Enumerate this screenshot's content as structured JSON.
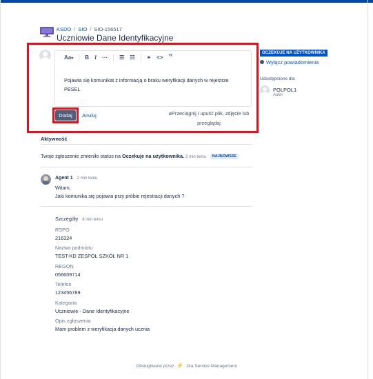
{
  "breadcrumb": {
    "project": "KSDO",
    "service": "SIO",
    "issue": "SIO-156517"
  },
  "request": {
    "title": "Uczniowie Dane Identyfikacyjne"
  },
  "editor": {
    "text_style_label": "Aa",
    "text": "Pojawia się komunikat z informacją o braku weryfikacji danych w rejestrze PESEL",
    "add_button": "Dodaj",
    "cancel_link": "Anuluj",
    "drop_hint": "Przeciągnij i upuść plik, zdjęcie lub",
    "browse_link": "przeglądaj"
  },
  "sidebar": {
    "status": "OCZEKUJE NA UŻYTKOWNIKA",
    "notifications": "Wyłącz powiadomienia",
    "shared_with_label": "Udostępnione dla",
    "user": {
      "name": "POLPOL1",
      "role": "Autor"
    }
  },
  "activity": {
    "heading": "Aktywność",
    "status_change": {
      "prefix": "Twoje zgłoszenie zmieniło status na",
      "status": "Oczekuje na użytkownika.",
      "time": "2 min temu",
      "badge": "NAJNOWSZE"
    },
    "comment": {
      "author": "Agent 1",
      "time": "2 min temu",
      "line1": "Witam,",
      "line2": "Jaki komunika się pojawia przy próbie rejestracji danych ?"
    },
    "details": {
      "title": "Szczegóły",
      "time": "8 min temu",
      "fields": [
        {
          "label": "RSPO",
          "value": "216324"
        },
        {
          "label": "Nazwa podmiotu",
          "value": "TEST-KD ZESPÓŁ SZKÓŁ NR 1"
        },
        {
          "label": "REGON",
          "value": "056609714"
        },
        {
          "label": "Telefon",
          "value": "123456789"
        },
        {
          "label": "Kategoria",
          "value": "Uczniowie - Dane Identyfikacyjne"
        },
        {
          "label": "Opis zgłoszenia",
          "value": "Mam problem z weryfikacja danych ucznia"
        }
      ]
    }
  },
  "footer": {
    "powered_by": "Obsługiwane przez",
    "product": "Jira Service Management"
  },
  "colors": {
    "highlight": "#e2101a",
    "link": "#0052cc",
    "status": "#0052cc"
  }
}
